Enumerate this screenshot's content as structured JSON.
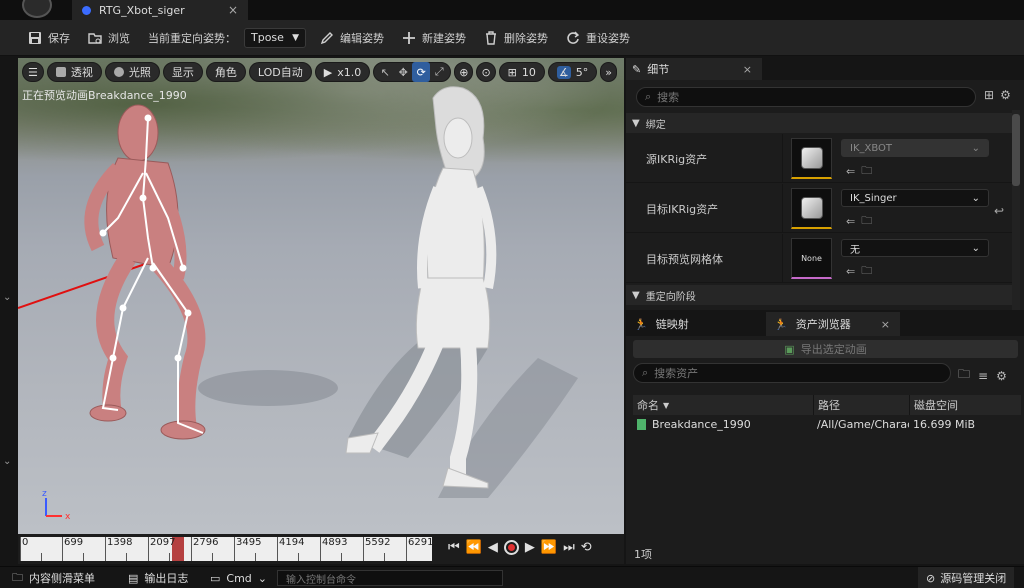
{
  "window": {
    "tab_title": "RTG_Xbot_siger",
    "tab_close": "×"
  },
  "toolbar": {
    "save": "保存",
    "browse": "浏览",
    "current_pose_label": "当前重定向姿势：",
    "current_pose_value": "Tpose",
    "edit_pose": "编辑姿势",
    "new_pose": "新建姿势",
    "delete_pose": "删除姿势",
    "reset_pose": "重设姿势"
  },
  "viewport": {
    "perspective": "透视",
    "lighting": "光照",
    "show": "显示",
    "character": "角色",
    "lod": "LOD自动",
    "speed": "x1.0",
    "grid_size": "10",
    "angle_snap": "5°",
    "preview_text": "正在预览动画Breakdance_1990",
    "axis_x": "x",
    "axis_z": "z"
  },
  "timeline": {
    "ticks": [
      "0",
      "699",
      "1398",
      "2097",
      "2796",
      "3495",
      "4194",
      "4893",
      "5592",
      "6291"
    ]
  },
  "details": {
    "tab_label": "细节",
    "search_placeholder": "搜索",
    "section_binding": "绑定",
    "section_retarget": "重定向阶段",
    "rows": [
      {
        "label": "源IKRig资产",
        "value": "IK_XBOT"
      },
      {
        "label": "目标IKRig资产",
        "value": "IK_Singer"
      },
      {
        "label": "目标预览网格体",
        "value": "无",
        "thumb_text": "None"
      }
    ]
  },
  "lower": {
    "chain_tab": "链映射",
    "assets_tab": "资产浏览器",
    "export_btn": "导出选定动画",
    "search_placeholder": "搜索资产",
    "columns": {
      "name": "命名",
      "path": "路径",
      "disk": "磁盘空间"
    },
    "rows": [
      {
        "name": "Breakdance_1990",
        "path": "/All/Game/Charac",
        "disk": "16.699 MiB"
      }
    ],
    "count": "1项"
  },
  "statusbar": {
    "content_drawer": "内容侧滑菜单",
    "output_log": "输出日志",
    "cmd": "Cmd",
    "console_placeholder": "输入控制台命令",
    "source_control": "源码管理关闭"
  }
}
